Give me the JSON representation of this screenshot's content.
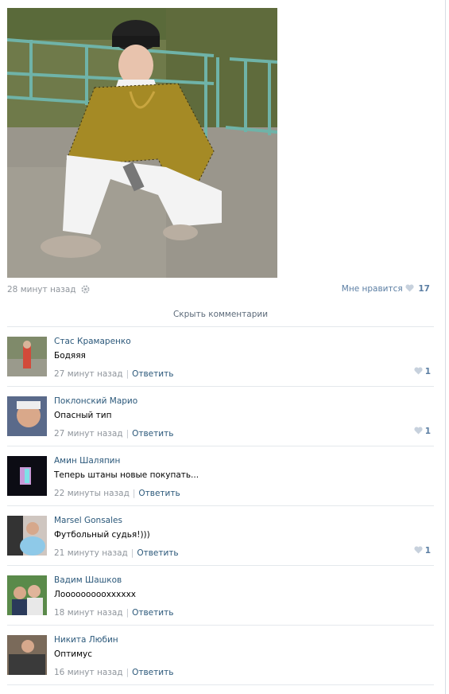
{
  "post": {
    "time": "28 минут назад",
    "like_label": "Мне нравится",
    "like_count": "17",
    "hide_comments": "Скрыть комментарии"
  },
  "comments": [
    {
      "author": "Стас Крамаренко",
      "text": "Бодяяя",
      "time": "27 минут назад",
      "reply": "Ответить",
      "likes": "1"
    },
    {
      "author": "Поклонский Марио",
      "text": "Опасный тип",
      "time": "27 минут назад",
      "reply": "Ответить",
      "likes": "1"
    },
    {
      "author": "Амин Шаляпин",
      "text": "Теперь штаны новые покупать...",
      "time": "22 минуты назад",
      "reply": "Ответить",
      "likes": ""
    },
    {
      "author": "Marsel Gonsales",
      "text": "Футбольный судья!)))",
      "time": "21 минуту назад",
      "reply": "Ответить",
      "likes": "1"
    },
    {
      "author": "Вадим Шашков",
      "text": "Лооооооооохххххх",
      "time": "18 минут назад",
      "reply": "Ответить",
      "likes": ""
    },
    {
      "author": "Никита Любин",
      "text": "Оптимус",
      "time": "16 минут назад",
      "reply": "Ответить",
      "likes": ""
    }
  ],
  "colors": {
    "link": "#2b587a",
    "muted": "#8f959c",
    "like": "#5b7ea3"
  }
}
